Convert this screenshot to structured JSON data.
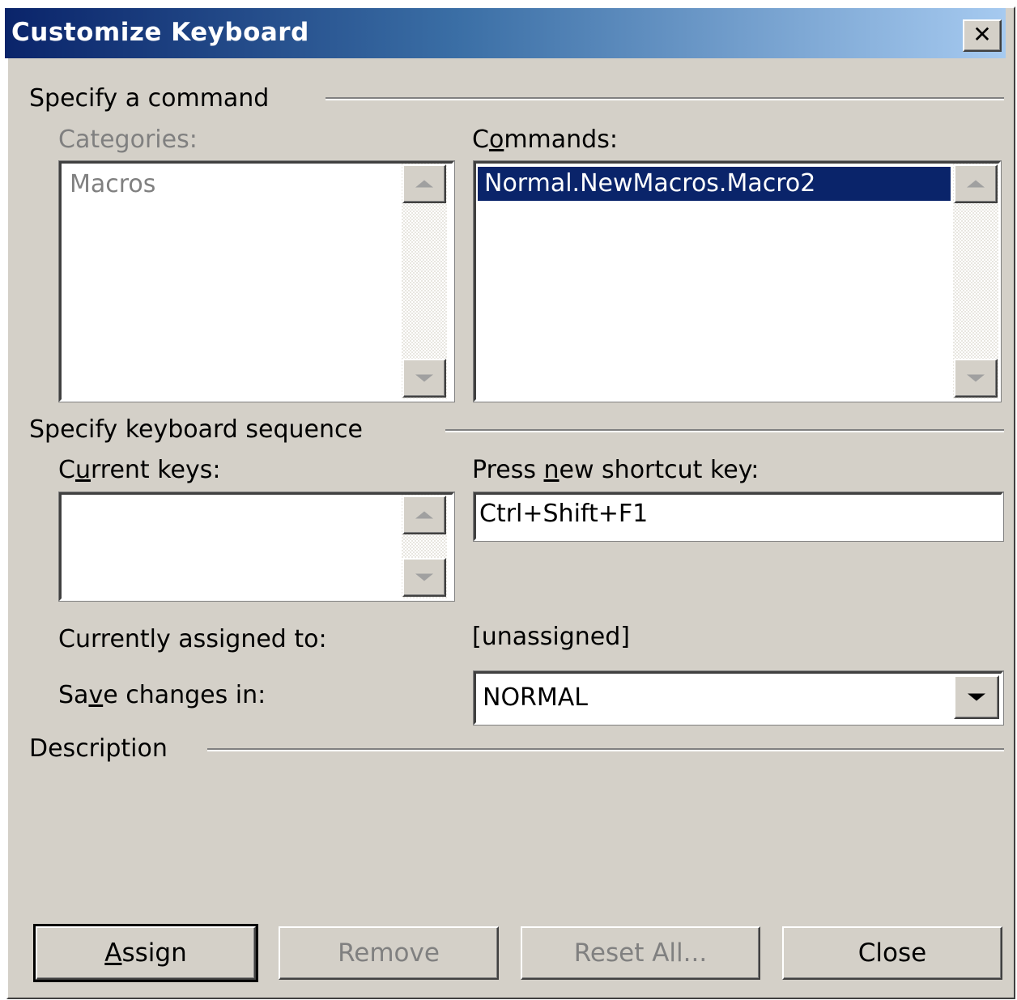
{
  "dialog": {
    "title": "Customize Keyboard",
    "close_glyph": "✕"
  },
  "specify_command": {
    "group_label": "Specify a command",
    "categories_label": "Categories:",
    "categories_items": [
      "Macros"
    ],
    "commands_label_pre": "C",
    "commands_label_key": "o",
    "commands_label_post": "mmands:",
    "commands_items": [
      "Normal.NewMacros.Macro2"
    ]
  },
  "keyboard_sequence": {
    "group_label": "Specify keyboard sequence",
    "current_keys_pre": "C",
    "current_keys_key": "u",
    "current_keys_post": "rrent keys:",
    "press_new_pre": "Press ",
    "press_new_key": "n",
    "press_new_post": "ew shortcut key:",
    "shortcut_value": "Ctrl+Shift+F1",
    "currently_assigned_label": "Currently assigned to:",
    "currently_assigned_value": "[unassigned]",
    "save_changes_pre": "Sa",
    "save_changes_key": "v",
    "save_changes_post": "e changes in:",
    "save_changes_value": "NORMAL"
  },
  "description": {
    "group_label": "Description"
  },
  "buttons": {
    "assign_key": "A",
    "assign_rest": "ssign",
    "remove": "Remove",
    "reset_all": "Reset All...",
    "close": "Close"
  }
}
